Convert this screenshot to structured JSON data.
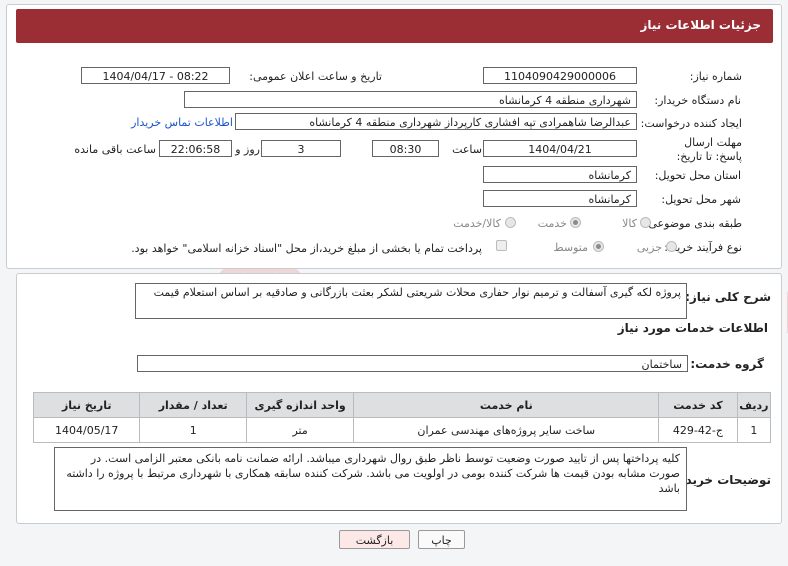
{
  "header": {
    "title": "جزئیات اطلاعات نیاز"
  },
  "fields": {
    "need_number_label": "شماره نیاز:",
    "need_number": "1104090429000006",
    "announce_label": "تاریخ و ساعت اعلان عمومی:",
    "announce_value": "1404/04/17 - 08:22",
    "buyer_org_label": "نام دستگاه خریدار:",
    "buyer_org": "شهرداری منطقه 4 کرمانشاه",
    "creator_label": "ایجاد کننده درخواست:",
    "creator": "عبدالرضا شاهمرادی تپه افشاری کارپرداز شهرداری منطقه 4 کرمانشاه",
    "contact_link": "اطلاعات تماس خریدار",
    "deadline_label": "مهلت ارسال پاسخ: تا تاریخ:",
    "deadline_date": "1404/04/21",
    "time_label": "ساعت",
    "deadline_time": "08:30",
    "days_value": "3",
    "days_label": "روز و",
    "remaining_time": "22:06:58",
    "remaining_label": "ساعت باقی مانده",
    "province_label": "استان محل تحویل:",
    "province": "کرمانشاه",
    "city_label": "شهر محل تحویل:",
    "city": "کرمانشاه",
    "category_label": "طبقه بندی موضوعی:",
    "category_options": [
      "کالا",
      "خدمت",
      "کالا/خدمت"
    ],
    "category_selected": "خدمت",
    "process_label": "نوع فرآیند خرید :",
    "process_options": [
      "جزیی",
      "متوسط"
    ],
    "process_selected": "متوسط",
    "payment_note": "پرداخت تمام یا بخشی از مبلغ خرید،از محل \"اسناد خزانه اسلامی\" خواهد بود."
  },
  "summary": {
    "label": "شرح کلی نیاز:",
    "text": "پروژه لکه گیری آسفالت و ترمیم نوار حفاری محلات شریعتی لشکر بعثت بازرگانی و صادقیه بر اساس استعلام قیمت"
  },
  "services": {
    "section_title": "اطلاعات خدمات مورد نیاز",
    "group_label": "گروه خدمت:",
    "group_value": "ساختمان",
    "columns": [
      "ردیف",
      "کد خدمت",
      "نام خدمت",
      "واحد اندازه گیری",
      "تعداد / مقدار",
      "تاریخ نیاز"
    ],
    "rows": [
      [
        "1",
        "ج-42-429",
        "ساخت سایر پروژه‌های مهندسی عمران",
        "متر",
        "1",
        "1404/05/17"
      ]
    ]
  },
  "buyer_notes": {
    "label": "توضیحات خریدار:",
    "text": "کلیه پرداختها پس از تایید صورت وضعیت توسط ناظر طبق روال شهرداری میباشد. ارائه ضمانت نامه بانکی معتبر الزامی است. در صورت مشابه بودن قیمت ها شرکت کننده بومی در اولویت می باشد. شرکت کننده سابقه همکاری با شهرداری مرتبط با پروژه را داشته باشد"
  },
  "buttons": {
    "print": "چاپ",
    "back": "بازگشت"
  },
  "watermark": "AriaTender.neT",
  "colors": {
    "header_bg": "#9b2d35",
    "link": "#1a55c9",
    "back_btn_bg": "#fde8e8"
  }
}
